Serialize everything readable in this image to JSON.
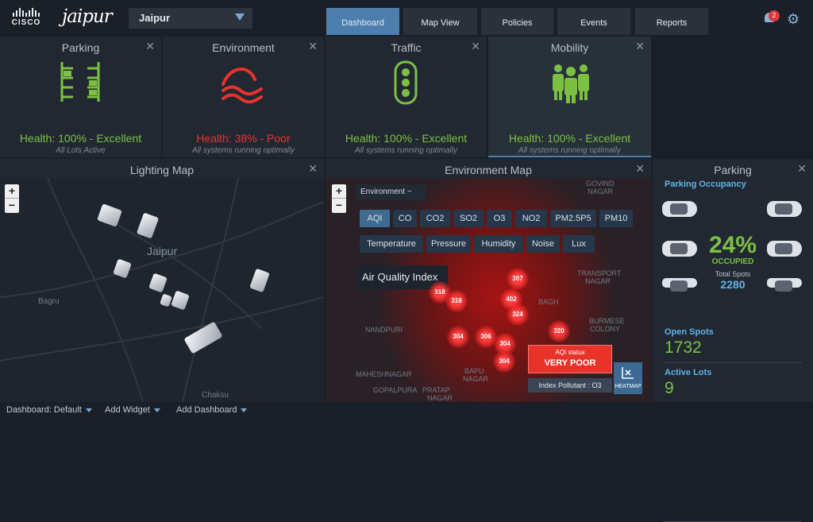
{
  "header": {
    "logo_text": "CISCO",
    "brand": "jaipur",
    "city_select": "Jaipur",
    "tabs": [
      "Dashboard",
      "Map View",
      "Policies",
      "Events",
      "Reports"
    ],
    "notification_count": "2"
  },
  "summary": {
    "parking": {
      "title": "Parking",
      "health": "Health: 100% - Excellent",
      "sub": "All Lots Active"
    },
    "environment": {
      "title": "Environment",
      "health": "Health: 38% - Poor",
      "sub": "All systems running optimally"
    },
    "traffic": {
      "title": "Traffic",
      "health": "Health: 100% - Excellent",
      "sub": "All systems running optimally"
    },
    "mobility": {
      "title": "Mobility",
      "health": "Health: 100% - Excellent",
      "sub": "All systems running optimally"
    }
  },
  "lighting_map": {
    "title": "Lighting Map",
    "labels": {
      "city": "Jaipur",
      "bagru": "Bagru",
      "chaksu": "Chaksu"
    }
  },
  "environment_map": {
    "title": "Environment Map",
    "dropdown": "Environment",
    "pollutants": [
      "AQI",
      "CO",
      "CO2",
      "SO2",
      "O3",
      "NO2",
      "PM2.5P5",
      "PM10"
    ],
    "metrics": [
      "Temperature",
      "Pressure",
      "Humidity",
      "Noise",
      "Lux"
    ],
    "index_label": "Air Quality Index",
    "aqi_values": [
      "307",
      "318",
      "318",
      "402",
      "324",
      "320",
      "304",
      "306",
      "304",
      "304"
    ],
    "status_label": "AQI status",
    "status_value": "VERY POOR",
    "pollutant": "Index Pollutant : O3",
    "heatmap": "HEATMAP",
    "places": {
      "govind": "GOVIND",
      "nagar": "NAGAR",
      "transport": "TRANSPORT",
      "tnagar": "NAGAR",
      "burmese": "BURMESE",
      "colony": "COLONY",
      "nandpuri": "NANDPURI",
      "bagh": "BAGH",
      "maheshnagar": "MAHESHNAGAR",
      "bapu": "BAPU",
      "bnagar": "NAGAR",
      "gopalpura": "GOPALPURA",
      "pratap": "PRATAP",
      "pnagar": "NAGAR"
    }
  },
  "parking": {
    "title": "Parking",
    "occupancy_label": "Parking Occupancy",
    "percent": "24%",
    "occupied": "OCCUPIED",
    "total_label": "Total Spots",
    "total": "2280",
    "open_label": "Open Spots",
    "open": "1732",
    "active_label": "Active Lots",
    "active": "9"
  },
  "footer": {
    "dashboard": "Dashboard: Default",
    "add_widget": "Add Widget",
    "add_dashboard": "Add Dashboard"
  },
  "colors": {
    "accent": "#4d7fae",
    "good": "#7bc043",
    "bad": "#e8332a"
  }
}
